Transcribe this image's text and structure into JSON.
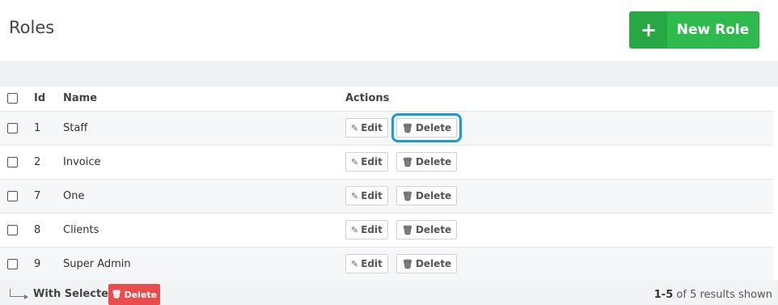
{
  "header": {
    "title": "Roles",
    "new_button_icon": "+",
    "new_button_label": "New Role"
  },
  "table": {
    "columns": {
      "id": "Id",
      "name": "Name",
      "actions": "Actions"
    },
    "rows": [
      {
        "id": "1",
        "name": "Staff"
      },
      {
        "id": "2",
        "name": "Invoice"
      },
      {
        "id": "7",
        "name": "One"
      },
      {
        "id": "8",
        "name": "Clients"
      },
      {
        "id": "9",
        "name": "Super Admin"
      }
    ],
    "edit_label": "Edit",
    "delete_label": "Delete",
    "edit_icon": "pencil-icon",
    "delete_icon": "trash-icon"
  },
  "footer": {
    "with_selected": "With Selected",
    "bulk_delete_label": "Delete",
    "results_range": "1-5",
    "results_text": "of 5 results shown"
  },
  "colors": {
    "new_button": "#2fba4e",
    "bulk_delete": "#e84c4c",
    "highlight": "#1a9ad6"
  }
}
